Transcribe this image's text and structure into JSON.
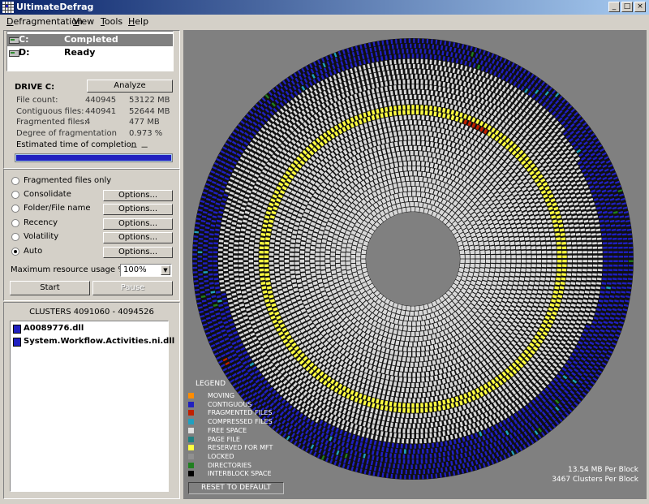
{
  "window": {
    "title": "UltimateDefrag",
    "btn_min": "_",
    "btn_max": "□",
    "btn_close": "×"
  },
  "menu": {
    "items": [
      {
        "label": "Defragmentation",
        "underline": "D",
        "rest": "efragmentation"
      },
      {
        "label": "View",
        "underline": "V",
        "rest": "iew"
      },
      {
        "label": "Tools",
        "underline": "T",
        "rest": "ools"
      },
      {
        "label": "Help",
        "underline": "H",
        "rest": "elp"
      }
    ]
  },
  "drives": [
    {
      "letter": "C:",
      "status": "Completed",
      "selected": true
    },
    {
      "letter": "D:",
      "status": "Ready",
      "selected": false
    }
  ],
  "drive_info": {
    "heading": "DRIVE C:",
    "analyze_label": "Analyze",
    "stats": [
      {
        "label": "File count:",
        "v1": "440945",
        "v2": "53122 MB"
      },
      {
        "label": "Contiguous files:",
        "v1": "440941",
        "v2": "52644 MB"
      },
      {
        "label": "Fragmented files:",
        "v1": "4",
        "v2": "477 MB"
      },
      {
        "label": "Degree of fragmentation",
        "v1": "",
        "v2": "0.973 %"
      }
    ],
    "eta_label": "Estimated time of completion",
    "eta_value": "－ －",
    "progress_percent": 100
  },
  "modes": {
    "items": [
      {
        "label": "Fragmented files only",
        "checked": false,
        "options_label": ""
      },
      {
        "label": "Consolidate",
        "checked": false,
        "options_label": "Options..."
      },
      {
        "label": "Folder/File name",
        "checked": false,
        "options_label": "Options..."
      },
      {
        "label": "Recency",
        "checked": false,
        "options_label": "Options..."
      },
      {
        "label": "Volatility",
        "checked": false,
        "options_label": "Options..."
      },
      {
        "label": "Auto",
        "checked": true,
        "options_label": "Options..."
      }
    ],
    "resource_label": "Maximum resource usage %",
    "resource_value": "100%",
    "start_label": "Start",
    "pause_label": "Pause"
  },
  "clusters": {
    "header": "CLUSTERS 4091060 - 4094526",
    "files": [
      "A0089776.dll",
      "System.Workflow.Activities.ni.dll"
    ]
  },
  "legend": {
    "title": "LEGEND",
    "items": [
      {
        "label": "MOVING",
        "color": "#ff8c00"
      },
      {
        "label": "CONTIGUOUS",
        "color": "#2020c0"
      },
      {
        "label": "FRAGMENTED FILES",
        "color": "#c02000"
      },
      {
        "label": "COMPRESSED FILES",
        "color": "#20a0c0"
      },
      {
        "label": "FREE SPACE",
        "color": "#e0e0e0"
      },
      {
        "label": "PAGE FILE",
        "color": "#208080"
      },
      {
        "label": "RESERVED FOR MFT",
        "color": "#ffff40"
      },
      {
        "label": "LOCKED",
        "color": "#909090"
      },
      {
        "label": "DIRECTORIES",
        "color": "#208020"
      },
      {
        "label": "INTERBLOCK SPACE",
        "color": "#000000"
      }
    ],
    "reset_label": "RESET TO DEFAULT"
  },
  "map_info": {
    "mb_per_block": "13.54 MB Per Block",
    "clusters_per_block": "3467 Clusters Per Block"
  },
  "colors": {
    "contiguous": "#2020c0",
    "free": "#d8d8d8",
    "mft": "#ffff40",
    "fragmented": "#c02000",
    "compressed": "#20a0c0",
    "directories": "#208020"
  }
}
